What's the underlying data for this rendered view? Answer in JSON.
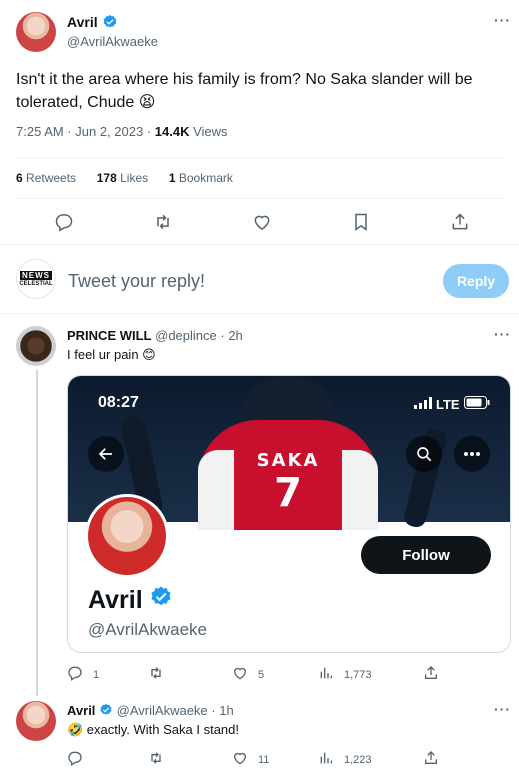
{
  "tweet": {
    "author_name": "Avril",
    "author_handle": "@AvrilAkwaeke",
    "text": "Isn't it the area where his family is from? No Saka slander will be tolerated, Chude 😫",
    "timestamp": "7:25 AM · Jun 2, 2023",
    "views_count": "14.4K",
    "views_label": "Views",
    "retweets_count": "6",
    "retweets_label": "Retweets",
    "likes_count": "178",
    "likes_label": "Likes",
    "bookmarks_count": "1",
    "bookmarks_label": "Bookmark",
    "more": "···"
  },
  "reply_box": {
    "avatar_text_top": "NEWS",
    "avatar_text_bottom": "CELESTIAL",
    "placeholder": "Tweet your reply!",
    "button": "Reply"
  },
  "reply1": {
    "author_name": "PRINCE WILL",
    "author_handle": "@deplince",
    "time": "· 2h",
    "text": "I feel ur pain 😊",
    "more": "···",
    "embed": {
      "phone_time": "08:27",
      "network": "LTE",
      "jersey_name": "SAKA",
      "jersey_number": "7",
      "profile_name": "Avril",
      "profile_handle": "@AvrilAkwaeke",
      "follow_button": "Follow"
    },
    "actions": {
      "replies": "1",
      "retweets": "",
      "likes": "5",
      "views": "1,773"
    }
  },
  "reply2": {
    "author_name": "Avril",
    "author_handle": "@AvrilAkwaeke",
    "time": "· 1h",
    "text": "🤣 exactly. With Saka I stand!",
    "more": "···",
    "actions": {
      "replies": "",
      "retweets": "",
      "likes": "11",
      "views": "1,223"
    }
  },
  "colors": {
    "verified": "#1d9bf0",
    "reply_button_disabled": "#8ecdf8",
    "text": "#0f1419",
    "muted": "#536471",
    "divider": "#eff3f4"
  }
}
